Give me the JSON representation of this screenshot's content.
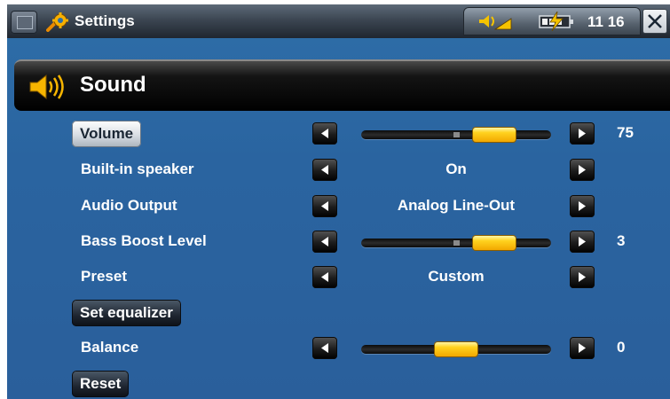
{
  "topbar": {
    "app_title": "Settings",
    "app_icon": "settings-gear-icon",
    "time": "11 16",
    "close_label": "close"
  },
  "section": {
    "title": "Sound",
    "icon": "speaker-icon"
  },
  "colors": {
    "accent_knob": "#ffc20e",
    "background": "#2a64a0",
    "header": "#000000"
  },
  "settings": {
    "volume": {
      "label": "Volume",
      "value": "75",
      "level": 0.75
    },
    "builtin_speaker": {
      "label": "Built-in speaker",
      "value": "On"
    },
    "audio_output": {
      "label": "Audio Output",
      "value": "Analog Line-Out"
    },
    "bass_boost": {
      "label": "Bass Boost Level",
      "value": "3",
      "level": 0.75
    },
    "preset": {
      "label": "Preset",
      "value": "Custom"
    },
    "set_equalizer": {
      "label": "Set equalizer"
    },
    "balance": {
      "label": "Balance",
      "value": "0",
      "level": 0.5
    },
    "reset": {
      "label": "Reset"
    }
  }
}
